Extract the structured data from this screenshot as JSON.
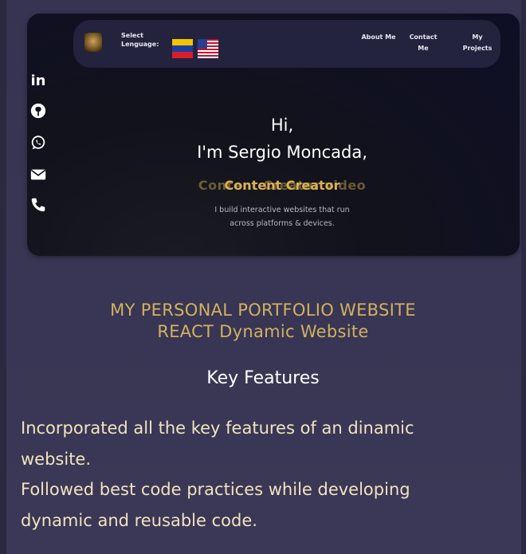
{
  "navbar": {
    "logo_alt": "Sergio Moncada logo",
    "language_label": "Select Lenguage:",
    "languages": [
      "Spanish (Venezuela flag)",
      "English (US flag)"
    ],
    "links": [
      "About Me",
      "Contact Me",
      "My Projects"
    ]
  },
  "social": {
    "linkedin_label": "in",
    "icons": [
      "linkedin-icon",
      "github-icon",
      "whatsapp-icon",
      "email-icon",
      "phone-icon"
    ]
  },
  "hero": {
    "greeting": "Hi,",
    "name_line": "I'm Sergio Moncada,",
    "role_primary": "Content Creator",
    "role_ghost": "Content Creator video",
    "tagline_line1": "I build interactive websites that run",
    "tagline_line2": "across platforms & devices."
  },
  "project": {
    "title_line1": "MY PERSONAL PORTFOLIO WEBSITE",
    "title_line2": "REACT Dynamic Website"
  },
  "features": {
    "heading": "Key Features",
    "line1": "Incorporated all the key features of an dinamic",
    "line2": "website.",
    "line3": "Followed best code practices while developing",
    "line4": "dynamic and reusable code."
  },
  "colors": {
    "background": "#363451",
    "hero": "#0e0f26",
    "navbar": "#23233e",
    "gold": "#d2b160",
    "feature_text": "#f1e3c0"
  }
}
